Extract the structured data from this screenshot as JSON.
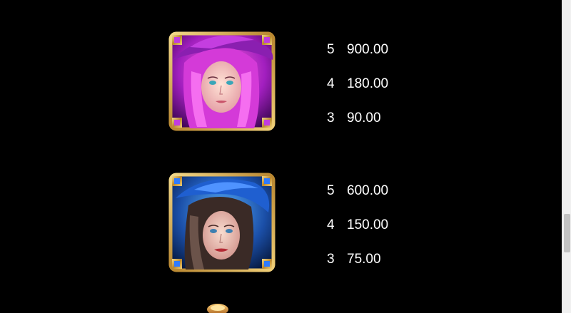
{
  "symbols": [
    {
      "icon": "purple-witch-symbol-icon",
      "frame_color": "#c9a24a",
      "accent_color": "#b63bd6",
      "payouts": [
        {
          "count": "5",
          "amount": "900.00"
        },
        {
          "count": "4",
          "amount": "180.00"
        },
        {
          "count": "3",
          "amount": "90.00"
        }
      ]
    },
    {
      "icon": "blue-witch-symbol-icon",
      "frame_color": "#c9a24a",
      "accent_color": "#2f6fd6",
      "payouts": [
        {
          "count": "5",
          "amount": "600.00"
        },
        {
          "count": "4",
          "amount": "150.00"
        },
        {
          "count": "3",
          "amount": "75.00"
        }
      ]
    }
  ],
  "partial_symbol_icon": "golden-cauldron-symbol-icon",
  "text_color": "#ffffff",
  "background_color": "#000000"
}
